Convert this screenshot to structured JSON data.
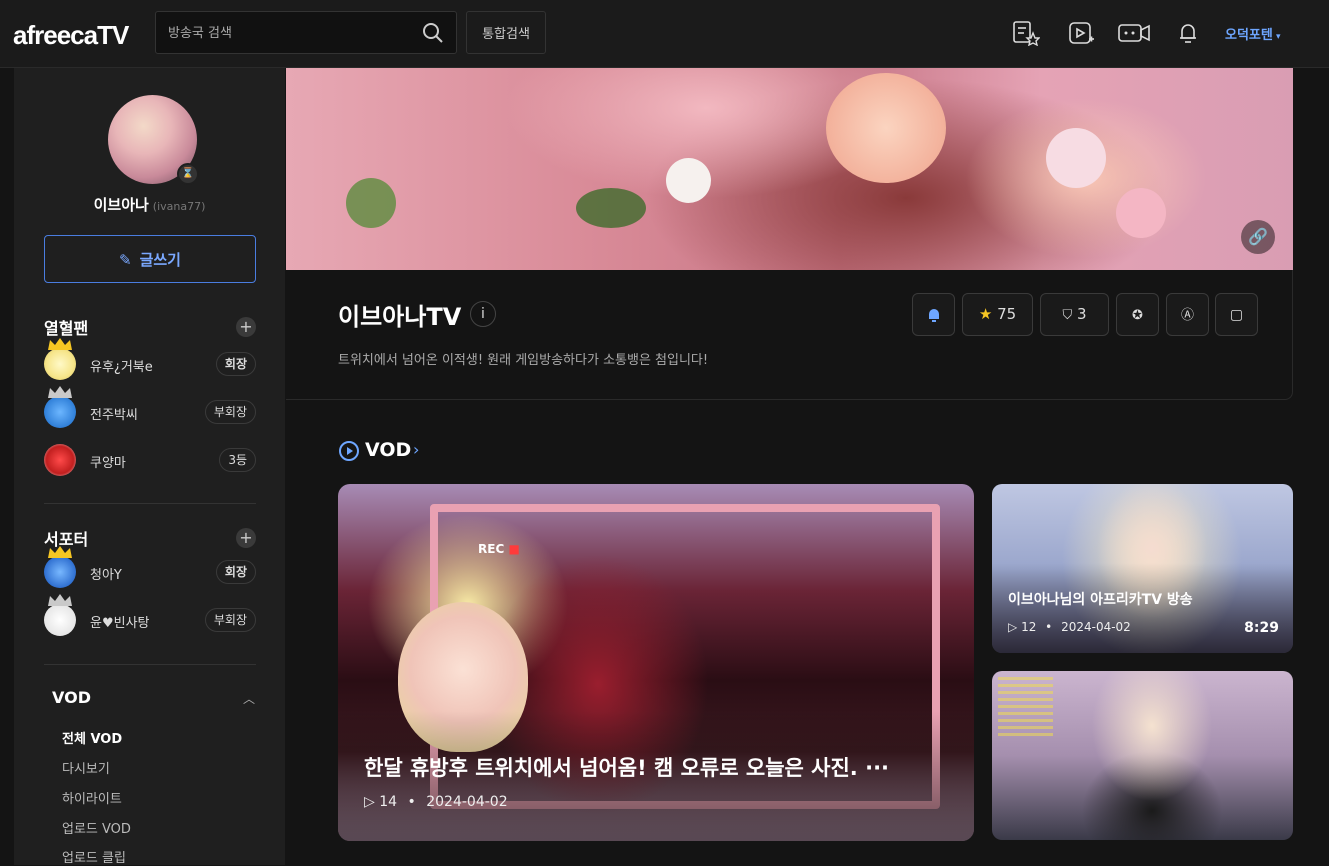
{
  "header": {
    "logo": "afreecaTV",
    "search_placeholder": "방송국 검색",
    "unified_search_label": "통합검색",
    "user_name": "오덕포텐"
  },
  "icons": {
    "search": "search-icon",
    "favorites": "star-list-icon",
    "vod_upload": "video-play-icon",
    "broadcast": "camera-icon",
    "notification": "bell-icon"
  },
  "profile": {
    "nickname": "이브아나",
    "user_id": "(ivana77)",
    "write_label": "글쓰기"
  },
  "fans": {
    "title": "열혈팬",
    "items": [
      {
        "name": "유후¿거북e",
        "badge": "회장",
        "crown": "gold"
      },
      {
        "name": "전주박씨",
        "badge": "부회장",
        "crown": "silver"
      },
      {
        "name": "쿠양마",
        "badge": "3등",
        "crown": "none"
      }
    ]
  },
  "supporters": {
    "title": "서포터",
    "items": [
      {
        "name": "청아Y",
        "badge": "회장",
        "crown": "gold"
      },
      {
        "name": "윤♥빈사탕",
        "badge": "부회장",
        "crown": "silver"
      }
    ]
  },
  "vod_menu": {
    "title": "VOD",
    "items": [
      "전체 VOD",
      "다시보기",
      "하이라이트",
      "업로드 VOD",
      "업로드 클립"
    ]
  },
  "channel": {
    "title": "이브아나TV",
    "info_icon": "i",
    "description": "트위치에서 넘어온 이적생! 원래 게임방송하다가 소통뱅은 첨입니다!",
    "favorite_count": "75",
    "subscription_count": "3"
  },
  "vod_section": {
    "title": "VOD",
    "arrow": "›"
  },
  "videos": [
    {
      "title": "한달 휴방후 트위치에서 넘어옴! 캠 오류로 오늘은 사진.",
      "views": "14",
      "date": "2024-04-02",
      "rec_label": "REC"
    },
    {
      "title": "이브아나님의 아프리카TV 방송",
      "views": "12",
      "date": "2024-04-02",
      "duration": "8:29"
    },
    {
      "title": "",
      "views": "",
      "date": ""
    }
  ],
  "colors": {
    "accent": "#6ea6ff",
    "gold_crown": "#f6c623",
    "silver_crown": "#c9c9c9"
  }
}
